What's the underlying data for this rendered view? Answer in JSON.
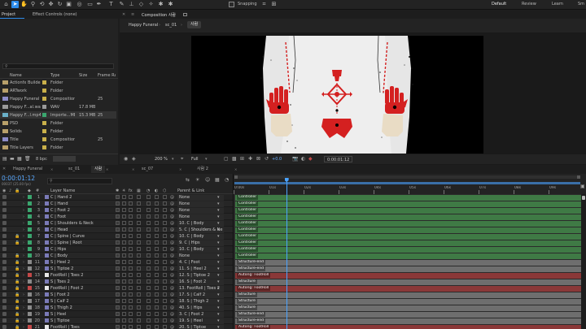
{
  "toolbar": {
    "snapping_label": "Snapping",
    "workspaces": [
      "Default",
      "Review",
      "Learn",
      "Sm"
    ]
  },
  "project": {
    "tab_project": "Project",
    "tab_effect_controls": "Effect Controls (none)",
    "columns": {
      "name": "Name",
      "type": "Type",
      "size": "Size",
      "frame_rate": "Frame Ra..."
    },
    "items": [
      {
        "name": "Actionfx Builder",
        "type": "Folder",
        "size": "",
        "rate": "",
        "icon": "folder",
        "swatch": "#c9b04a"
      },
      {
        "name": "ARTwork",
        "type": "Folder",
        "size": "",
        "rate": "",
        "icon": "folder",
        "swatch": "#c9b04a"
      },
      {
        "name": "Happy Funeral",
        "type": "Composition",
        "size": "",
        "rate": "25",
        "icon": "composition",
        "swatch": "#c9b04a"
      },
      {
        "name": "Happy F...al.wav",
        "type": "WAV",
        "size": "17.8 MB",
        "rate": "",
        "icon": "audio",
        "swatch": "#9a9a9a"
      },
      {
        "name": "Happy F...l.mp4",
        "type": "Importe...MEX",
        "size": "15.3 MB",
        "rate": "25",
        "icon": "footage",
        "swatch": "#3aa66e"
      },
      {
        "name": "PSD",
        "type": "Folder",
        "size": "",
        "rate": "",
        "icon": "folder",
        "swatch": "#c9b04a"
      },
      {
        "name": "Solids",
        "type": "Folder",
        "size": "",
        "rate": "",
        "icon": "folder",
        "swatch": "#c9b04a"
      },
      {
        "name": "Title",
        "type": "Composition",
        "size": "",
        "rate": "25",
        "icon": "composition",
        "swatch": "#c9b04a"
      },
      {
        "name": "Title Layers",
        "type": "Folder",
        "size": "",
        "rate": "",
        "icon": "folder",
        "swatch": "#c9b04a"
      }
    ],
    "bpc_label": "8 bpc"
  },
  "composition": {
    "tab_label": "Composition 사람",
    "breadcrumbs": [
      "Happy Funeral",
      "sc_01",
      "사람"
    ],
    "zoom": "200 %",
    "resolution": "Full",
    "exposure": "+0.0",
    "timecode": "0:00:01:12"
  },
  "timeline": {
    "tabs": [
      "Happy Funeral",
      "sc_01",
      "사람",
      "sc_07",
      "사람 2"
    ],
    "active_tab": 2,
    "current_time": "0:00:01:12",
    "frame_info": "00037 (25.00 fps)",
    "search_placeholder": "",
    "col_layer_name": "Layer Name",
    "col_parent": "Parent & Link",
    "ruler_ticks": [
      "0:00s",
      "01s",
      "02s",
      "03s",
      "04s",
      "05s",
      "06s",
      "07s",
      "08s",
      "09s"
    ],
    "playhead_seconds": 1.48,
    "layers": [
      {
        "num": "1",
        "name": "C | Hand 2",
        "parent": "None",
        "bar": "Controller",
        "label_color": "#3aa66e",
        "bar_color": "#3f7a45",
        "kind": "shape",
        "locked": false
      },
      {
        "num": "2",
        "name": "C | Hand",
        "parent": "None",
        "bar": "Controller",
        "label_color": "#3aa66e",
        "bar_color": "#3f7a45",
        "kind": "shape",
        "locked": false
      },
      {
        "num": "3",
        "name": "C | Foot 2",
        "parent": "None",
        "bar": "Controller",
        "label_color": "#3aa66e",
        "bar_color": "#3f7a45",
        "kind": "shape",
        "locked": false
      },
      {
        "num": "4",
        "name": "C | Foot",
        "parent": "None",
        "bar": "Controller",
        "label_color": "#3aa66e",
        "bar_color": "#3f7a45",
        "kind": "shape",
        "locked": false
      },
      {
        "num": "5",
        "name": "C | Shoulders & Neck",
        "parent": "10. C | Body",
        "bar": "Controller",
        "label_color": "#3aa66e",
        "bar_color": "#3f7a45",
        "kind": "shape",
        "locked": false
      },
      {
        "num": "6",
        "name": "C | Head",
        "parent": "5. C | Shoulders & Ne",
        "bar": "Controller",
        "label_color": "#3aa66e",
        "bar_color": "#3f7a45",
        "kind": "shape",
        "locked": false
      },
      {
        "num": "7",
        "name": "C | Spine | Curve",
        "parent": "10. C | Body",
        "bar": "Controller",
        "label_color": "#3aa66e",
        "bar_color": "#3f7a45",
        "kind": "shape",
        "locked": true
      },
      {
        "num": "8",
        "name": "C | Spine | Root",
        "parent": "9. C | Hips",
        "bar": "Controller",
        "label_color": "#3aa66e",
        "bar_color": "#3f7a45",
        "kind": "shape",
        "locked": true
      },
      {
        "num": "9",
        "name": "C | Hips",
        "parent": "10. C | Body",
        "bar": "Controller",
        "label_color": "#3aa66e",
        "bar_color": "#3f7a45",
        "kind": "shape",
        "locked": false
      },
      {
        "num": "10",
        "name": "C | Body",
        "parent": "None",
        "bar": "Controller",
        "label_color": "#3aa66e",
        "bar_color": "#3f7a45",
        "kind": "shape",
        "locked": true
      },
      {
        "num": "11",
        "name": "S | Heel 2",
        "parent": "4. C | Foot",
        "bar": "Structure-end",
        "label_color": "#8a8a8a",
        "bar_color": "#6e6e6e",
        "kind": "shape",
        "locked": true
      },
      {
        "num": "12",
        "name": "S | Tiptoe 2",
        "parent": "11. S | Heel 2",
        "bar": "Structure-end",
        "label_color": "#8a8a8a",
        "bar_color": "#6e6e6e",
        "kind": "shape",
        "locked": true
      },
      {
        "num": "13",
        "name": "FootRoll | Toes 2",
        "parent": "12. S | Tiptoe 2",
        "bar": "Autorig: FootRoll",
        "label_color": "#c44848",
        "bar_color": "#8a3838",
        "kind": "solid",
        "locked": true
      },
      {
        "num": "14",
        "name": "S | Toes 2",
        "parent": "16. S | Foot 2",
        "bar": "Structure",
        "label_color": "#8a8a8a",
        "bar_color": "#6e6e6e",
        "kind": "shape",
        "locked": true
      },
      {
        "num": "15",
        "name": "FootRoll | Foot 2",
        "parent": "13. FootRoll | Toes 2",
        "bar": "Autorig: FootRoll",
        "label_color": "#c44848",
        "bar_color": "#8a3838",
        "kind": "solid",
        "locked": true
      },
      {
        "num": "16",
        "name": "S | Foot 2",
        "parent": "17. S | Calf 2",
        "bar": "Structure",
        "label_color": "#8a8a8a",
        "bar_color": "#6e6e6e",
        "kind": "shape",
        "locked": true
      },
      {
        "num": "17",
        "name": "S | Calf 2",
        "parent": "18. S | Thigh 2",
        "bar": "Structure",
        "label_color": "#8a8a8a",
        "bar_color": "#6e6e6e",
        "kind": "shape",
        "locked": true
      },
      {
        "num": "18",
        "name": "S | Thigh 2",
        "parent": "40. S | Hips",
        "bar": "Structure",
        "label_color": "#8a8a8a",
        "bar_color": "#6e6e6e",
        "kind": "shape",
        "locked": true
      },
      {
        "num": "19",
        "name": "S | Heel",
        "parent": "3. C | Foot 2",
        "bar": "Structure-end",
        "label_color": "#8a8a8a",
        "bar_color": "#6e6e6e",
        "kind": "shape",
        "locked": true
      },
      {
        "num": "20",
        "name": "S | Tiptoe",
        "parent": "19. S | Heel",
        "bar": "Structure-end",
        "label_color": "#8a8a8a",
        "bar_color": "#6e6e6e",
        "kind": "shape",
        "locked": true
      },
      {
        "num": "21",
        "name": "FootRoll | Toes",
        "parent": "20. S | Tiptoe",
        "bar": "Autorig: FootRoll",
        "label_color": "#c44848",
        "bar_color": "#8a3838",
        "kind": "solid",
        "locked": true
      }
    ]
  },
  "colors": {
    "accent": "#2d8ceb",
    "playhead": "#4aa3ff",
    "work_area": "#3a6fa8"
  },
  "icons": [
    "selection-tool-icon",
    "hand-tool-icon",
    "zoom-tool-icon",
    "pen-tool-icon",
    "text-tool-icon",
    "search-icon",
    "folder-icon",
    "composition-icon",
    "trash-icon",
    "camera-icon",
    "eye-icon",
    "lock-icon"
  ]
}
